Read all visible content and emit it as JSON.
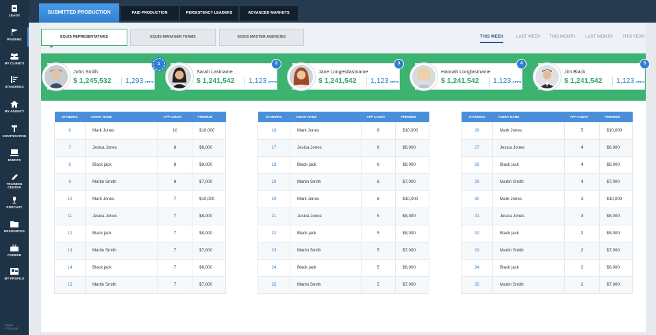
{
  "sidebar": {
    "items": [
      {
        "label": "LEADS",
        "icon": "leads-icon"
      },
      {
        "label": "PENDING",
        "icon": "flag-icon"
      },
      {
        "label": "MY CLIENTS",
        "icon": "clients-icon"
      },
      {
        "label": "STANDINGS",
        "icon": "standings-icon"
      },
      {
        "label": "MY AGENCY",
        "icon": "home-icon"
      },
      {
        "label": "CONTRACTING",
        "icon": "contract-icon"
      },
      {
        "label": "EVENTS",
        "icon": "events-icon"
      },
      {
        "label": "TRAINING CENTER",
        "icon": "pencil-icon"
      },
      {
        "label": "PODCAST",
        "icon": "microphone-icon"
      },
      {
        "label": "RESOURCES",
        "icon": "folder-icon"
      },
      {
        "label": "CAREER",
        "icon": "briefcase-icon"
      },
      {
        "label": "MY PROFILE",
        "icon": "profile-card-icon"
      }
    ],
    "footer": "Equis Financial"
  },
  "header": {
    "tabs": [
      {
        "label": "SUBMITTED PRODUCTION",
        "active": true
      },
      {
        "label": "PAID PRODUCTION",
        "active": false
      },
      {
        "label": "PERSISTENCY LEADERS",
        "active": false
      },
      {
        "label": "ADVANCED MARKETS",
        "active": false
      }
    ]
  },
  "subtabs": [
    {
      "label": "EQUIS REPRESENTATIVES",
      "active": true
    },
    {
      "label": "EQUIS MANAGER TEAMS",
      "active": false
    },
    {
      "label": "EQUIS MASTER AGENCIES",
      "active": false
    }
  ],
  "periods": [
    {
      "label": "THIS WEEK",
      "active": true
    },
    {
      "label": "LAST WEEK",
      "active": false
    },
    {
      "label": "THIS MONTH",
      "active": false
    },
    {
      "label": "LAST MONTH",
      "active": false
    },
    {
      "label": "THIS YEAR",
      "active": false
    }
  ],
  "leaders": [
    {
      "rank": "1",
      "name": "John Smith",
      "premium": "$ 1,245,532",
      "apps": "1,293",
      "apps_label": "APPS"
    },
    {
      "rank": "2",
      "name": "Sarah Lastname",
      "premium": "$ 1,241,542",
      "apps": "1,123",
      "apps_label": "APPS"
    },
    {
      "rank": "3",
      "name": "Jane Longestlastname",
      "premium": "$ 1,241,542",
      "apps": "1,123",
      "apps_label": "APPS"
    },
    {
      "rank": "4",
      "name": "Hannah Longlastname",
      "premium": "$ 1,241,542",
      "apps": "1,123",
      "apps_label": "APPS"
    },
    {
      "rank": "5",
      "name": "Jim Black",
      "premium": "$ 1,241,542",
      "apps": "1,123",
      "apps_label": "APPS"
    }
  ],
  "table_headers": [
    "STANDING",
    "AGENT NAME",
    "APP COUNT",
    "PREMIUM"
  ],
  "tables": [
    [
      [
        "6",
        "Mark Jones",
        "10",
        "$10,000"
      ],
      [
        "7",
        "Jesica Jones",
        "8",
        "$8,000"
      ],
      [
        "8",
        "Black jack",
        "8",
        "$8,000"
      ],
      [
        "9",
        "Martin Smith",
        "8",
        "$7,000"
      ],
      [
        "10",
        "Mark Jones",
        "7",
        "$10,000"
      ],
      [
        "11",
        "Jesica Jones",
        "7",
        "$8,000"
      ],
      [
        "12",
        "Black jack",
        "7",
        "$8,000"
      ],
      [
        "13",
        "Martin Smith",
        "7",
        "$7,000"
      ],
      [
        "14",
        "Black jack",
        "7",
        "$8,000"
      ],
      [
        "15",
        "Martin Smith",
        "7",
        "$7,000"
      ]
    ],
    [
      [
        "16",
        "Mark Jones",
        "6",
        "$10,000"
      ],
      [
        "17",
        "Jesica Jones",
        "6",
        "$8,000"
      ],
      [
        "18",
        "Black jack",
        "6",
        "$8,000"
      ],
      [
        "19",
        "Martin Smith",
        "6",
        "$7,000"
      ],
      [
        "20",
        "Mark Jones",
        "6",
        "$10,000"
      ],
      [
        "21",
        "Jesica Jones",
        "5",
        "$8,000"
      ],
      [
        "22",
        "Black jack",
        "5",
        "$8,000"
      ],
      [
        "23",
        "Martin Smith",
        "5",
        "$7,000"
      ],
      [
        "24",
        "Black jack",
        "5",
        "$8,000"
      ],
      [
        "25",
        "Martin Smith",
        "5",
        "$7,000"
      ]
    ],
    [
      [
        "26",
        "Mark Jones",
        "5",
        "$10,000"
      ],
      [
        "27",
        "Jesica Jones",
        "4",
        "$8,000"
      ],
      [
        "28",
        "Black jack",
        "4",
        "$8,000"
      ],
      [
        "29",
        "Martin Smith",
        "4",
        "$7,000"
      ],
      [
        "30",
        "Mark Jones",
        "3",
        "$10,000"
      ],
      [
        "31",
        "Jesica Jones",
        "3",
        "$8,000"
      ],
      [
        "32",
        "Black jack",
        "2",
        "$8,000"
      ],
      [
        "33",
        "Martin Smith",
        "2",
        "$7,000"
      ],
      [
        "34",
        "Black jack",
        "2",
        "$8,000"
      ],
      [
        "35",
        "Martin Smith",
        "2",
        "$7,000"
      ]
    ]
  ],
  "colors": {
    "accent_blue": "#2f7fcf",
    "leader_green": "#3cb371",
    "sidebar": "#1f3347",
    "header": "#273b50"
  }
}
